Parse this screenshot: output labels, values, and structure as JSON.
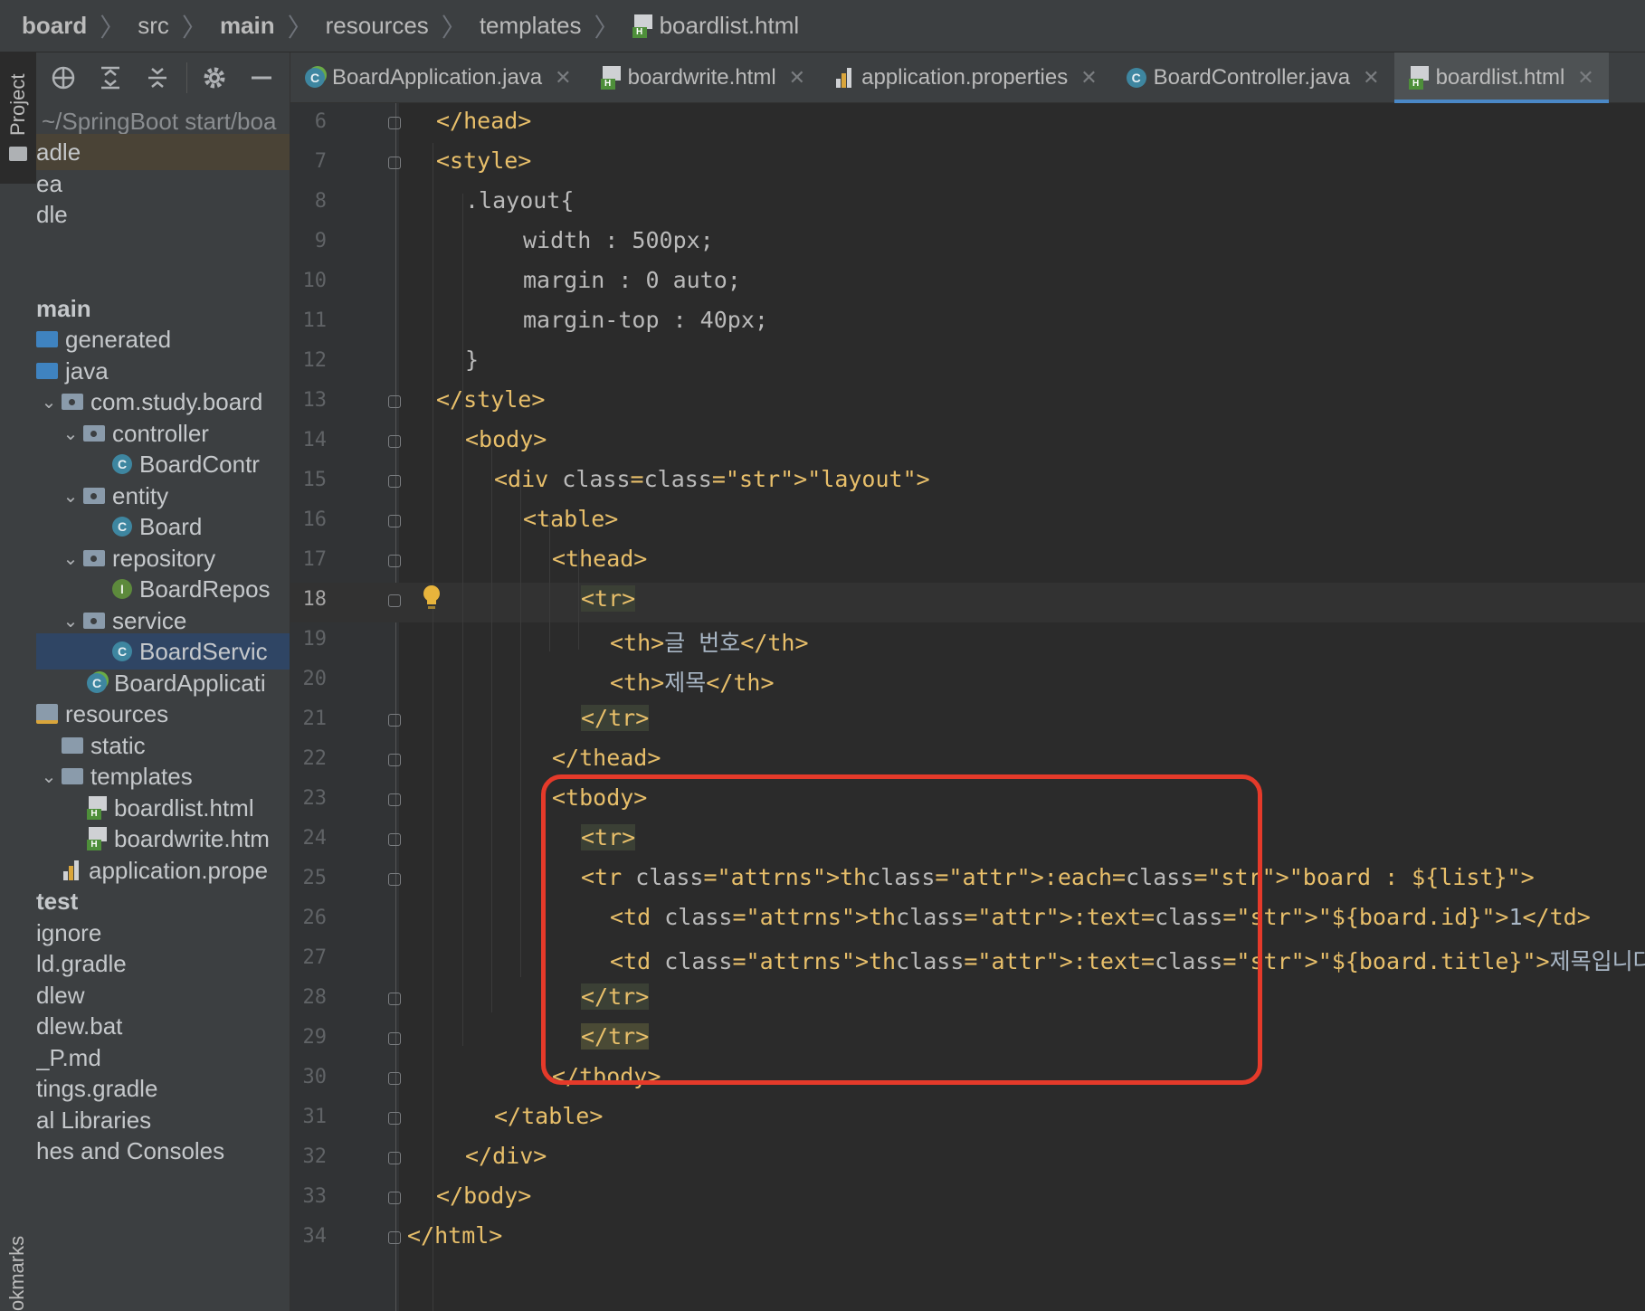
{
  "breadcrumb": {
    "items": [
      "board",
      "src",
      "main",
      "resources",
      "templates",
      "boardlist.html"
    ]
  },
  "toolstrip": {
    "project_label": "Project",
    "bookmarks_label": "okmarks"
  },
  "project_panel": {
    "tree": [
      {
        "label": "~/SpringBoot start/boa",
        "style": "dim"
      },
      {
        "label": "adle",
        "style": "hl"
      },
      {
        "label": "ea",
        "style": ""
      },
      {
        "label": "dle",
        "style": ""
      },
      {
        "label": "",
        "style": ""
      },
      {
        "label": "main",
        "style": "bold"
      },
      {
        "label": "generated",
        "icon": "generated-folder-icon"
      },
      {
        "label": "java",
        "icon": "source-folder-icon"
      },
      {
        "label": "com.study.board",
        "icon": "package-icon",
        "expanded": true
      },
      {
        "label": "controller",
        "icon": "package-icon",
        "expanded": true
      },
      {
        "label": "BoardContr",
        "icon": "class-icon"
      },
      {
        "label": "entity",
        "icon": "package-icon",
        "expanded": true
      },
      {
        "label": "Board",
        "icon": "class-icon"
      },
      {
        "label": "repository",
        "icon": "package-icon",
        "expanded": true
      },
      {
        "label": "BoardRepos",
        "icon": "interface-icon"
      },
      {
        "label": "service",
        "icon": "package-icon",
        "expanded": true
      },
      {
        "label": "BoardServic",
        "icon": "class-icon",
        "selected": true
      },
      {
        "label": "BoardApplicati",
        "icon": "spring-class-icon"
      },
      {
        "label": "resources",
        "icon": "resources-folder-icon"
      },
      {
        "label": "static",
        "icon": "folder-icon"
      },
      {
        "label": "templates",
        "icon": "folder-icon",
        "expanded": true
      },
      {
        "label": "boardlist.html",
        "icon": "html-file-icon"
      },
      {
        "label": "boardwrite.htm",
        "icon": "html-file-icon"
      },
      {
        "label": "application.prope",
        "icon": "properties-file-icon"
      },
      {
        "label": "test",
        "style": "bold"
      },
      {
        "label": "ignore"
      },
      {
        "label": "ld.gradle"
      },
      {
        "label": "dlew"
      },
      {
        "label": "dlew.bat"
      },
      {
        "label": "_P.md"
      },
      {
        "label": "tings.gradle"
      },
      {
        "label": "al Libraries"
      },
      {
        "label": "hes and Consoles"
      }
    ]
  },
  "tabs": [
    {
      "label": "BoardApplication.java",
      "icon": "spring-class-icon",
      "active": false
    },
    {
      "label": "boardwrite.html",
      "icon": "html-file-icon",
      "active": false
    },
    {
      "label": "application.properties",
      "icon": "properties-file-icon",
      "active": false
    },
    {
      "label": "BoardController.java",
      "icon": "class-icon",
      "active": false
    },
    {
      "label": "boardlist.html",
      "icon": "html-file-icon",
      "active": true
    }
  ],
  "editor": {
    "lines": [
      {
        "n": "6",
        "t": "</head>"
      },
      {
        "n": "7",
        "t": "<style>"
      },
      {
        "n": "8",
        "t": ".layout{"
      },
      {
        "n": "9",
        "t": "width : 500px;"
      },
      {
        "n": "10",
        "t": "margin : 0 auto;"
      },
      {
        "n": "11",
        "t": "margin-top : 40px;"
      },
      {
        "n": "12",
        "t": "}"
      },
      {
        "n": "13",
        "t": "</style>"
      },
      {
        "n": "14",
        "t": "<body>"
      },
      {
        "n": "15",
        "t": "<div class=\"layout\">"
      },
      {
        "n": "16",
        "t": "<table>"
      },
      {
        "n": "17",
        "t": "<thead>"
      },
      {
        "n": "18",
        "t": "<tr>"
      },
      {
        "n": "19",
        "t": "<th>글 번호</th>"
      },
      {
        "n": "20",
        "t": "<th>제목</th>"
      },
      {
        "n": "21",
        "t": "</tr>"
      },
      {
        "n": "22",
        "t": "</thead>"
      },
      {
        "n": "23",
        "t": "<tbody>"
      },
      {
        "n": "24",
        "t": "<tr>"
      },
      {
        "n": "25",
        "t": "<tr th:each=\"board : ${list}\">"
      },
      {
        "n": "26",
        "t": "<td th:text=\"${board.id}\">1</td>"
      },
      {
        "n": "27",
        "t": "<td th:text=\"${board.title}\">제목입니다.</td>"
      },
      {
        "n": "28",
        "t": "</tr>"
      },
      {
        "n": "29",
        "t": "</tr>"
      },
      {
        "n": "30",
        "t": "</tbody>"
      },
      {
        "n": "31",
        "t": "</table>"
      },
      {
        "n": "32",
        "t": "</div>"
      },
      {
        "n": "33",
        "t": "</body>"
      },
      {
        "n": "34",
        "t": "</html>"
      }
    ],
    "current_line": "18"
  },
  "colors": {
    "tag": "#e8bf6a",
    "string": "#a5c25c",
    "attr_namespace": "#9876aa",
    "highlight_box": "#e53a2a",
    "active_tab_underline": "#4a88c7"
  }
}
